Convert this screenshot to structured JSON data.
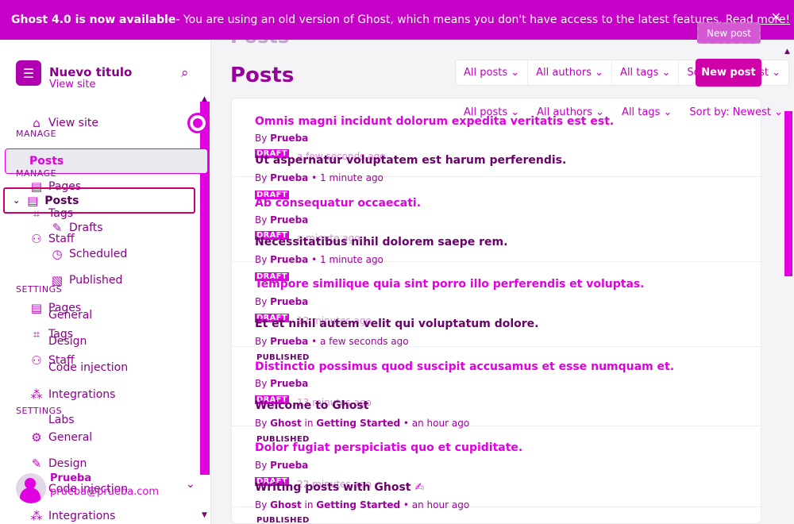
{
  "banner": {
    "title": "Ghost 4.0 is now available",
    "text": " - You are using an old version of Ghost, which means you don't have access to the latest features.",
    "link": "Read more!"
  },
  "sidebar": {
    "site_title": "Nuevo titulo",
    "view_site_small": "View site",
    "manage_label": "MANAGE",
    "settings_label": "SETTINGS",
    "items": {
      "view_site": "View site",
      "posts_ghost": "Posts",
      "pages_ghost": "Pages",
      "posts": "Posts",
      "tags_ghost": "Tags",
      "drafts": "Drafts",
      "staff_ghost": "Staff",
      "scheduled": "Scheduled",
      "published": "Published",
      "pages": "Pages",
      "general_ghost": "General",
      "tags": "Tags",
      "design_ghost": "Design",
      "staff": "Staff",
      "code_ghost": "Code injection",
      "integrations_ghost": "Integrations",
      "labs": "Labs",
      "general": "General",
      "design": "Design",
      "code": "Code injection",
      "integrations": "Integrations"
    },
    "user": {
      "name": "Prueba",
      "email": "prueba@prueba.com"
    }
  },
  "main": {
    "ghost_title": "Posts",
    "title": "Posts",
    "filters": [
      "All posts",
      "All authors",
      "All tags",
      "Sort by: Newest"
    ],
    "new_post": "New post",
    "posts": [
      {
        "title": "Omnis magni incidunt dolorum expedita veritatis est est.",
        "author": "Prueba",
        "status": "DRAFT",
        "ago": "a few seconds ago"
      },
      {
        "title": "Ut aspernatur voluptatem est harum perferendis.",
        "author": "Prueba",
        "time": "1 minute ago",
        "status": "DRAFT"
      },
      {
        "title": "Ab consequatur occaecati.",
        "author": "Prueba",
        "status": "DRAFT",
        "ago": "a minute ago"
      },
      {
        "title": "Necessitatibus nihil dolorem saepe rem.",
        "author": "Prueba",
        "time": "1 minute ago",
        "status": "DRAFT"
      },
      {
        "title": "Tempore similique quia sint porro illo perferendis et voluptas.",
        "author": "Prueba",
        "status": "DRAFT",
        "ago": "12 minutes ago"
      },
      {
        "title": "Et et nihil autem velit qui voluptatum dolore.",
        "author": "Prueba",
        "time": "a few seconds ago",
        "status": "PUBLISHED"
      },
      {
        "title": "Distinctio possimus quod suscipit accusamus et esse numquam et.",
        "author": "Prueba",
        "status": "DRAFT",
        "ago": "13 minutes ago"
      },
      {
        "title": "Welcome to Ghost",
        "author": "Ghost",
        "tag": "Getting Started",
        "time": "an hour ago",
        "status": "PUBLISHED"
      },
      {
        "title": "Dolor fugiat perspiciatis quo et cupiditate.",
        "author": "Prueba",
        "status": "DRAFT",
        "ago": "22 minutes ago"
      },
      {
        "title": "Writing posts with Ghost",
        "author": "Ghost",
        "tag": "Getting Started",
        "time": "an hour ago",
        "status": "PUBLISHED"
      }
    ],
    "by": "By",
    "in": "in",
    "sep": "•"
  }
}
